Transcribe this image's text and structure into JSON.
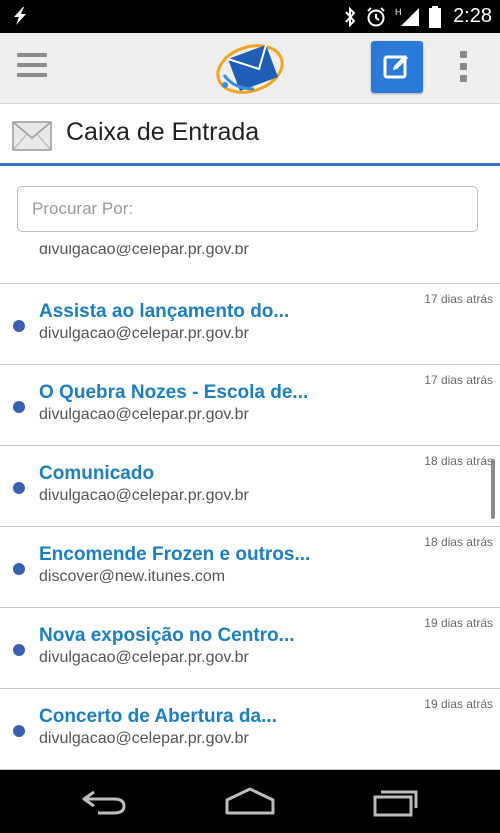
{
  "status_bar": {
    "time": "2:28",
    "left_icon": "flash-icon",
    "icons": [
      "bluetooth-icon",
      "alarm-icon",
      "signal-icon",
      "battery-icon"
    ],
    "network_label": "H"
  },
  "app_bar": {
    "menu_icon": "menu-icon",
    "logo": "mail-logo",
    "compose_icon": "compose-icon",
    "overflow_icon": "overflow-menu-icon"
  },
  "header": {
    "title": "Caixa de Entrada",
    "icon": "envelope-icon"
  },
  "search": {
    "placeholder": "Procurar Por:",
    "value": ""
  },
  "list": {
    "partial_sender": "divulgacao@celepar.pr.gov.br",
    "items": [
      {
        "subject": "Assista ao lançamento do...",
        "sender": "divulgacao@celepar.pr.gov.br",
        "date": "17 dias atrás"
      },
      {
        "subject": "O Quebra Nozes - Escola de...",
        "sender": "divulgacao@celepar.pr.gov.br",
        "date": "17 dias atrás"
      },
      {
        "subject": "Comunicado",
        "sender": "divulgacao@celepar.pr.gov.br",
        "date": "18 dias atrás"
      },
      {
        "subject": "Encomende Frozen e outros...",
        "sender": "discover@new.itunes.com",
        "date": "18 dias atrás"
      },
      {
        "subject": "Nova exposição no Centro...",
        "sender": "divulgacao@celepar.pr.gov.br",
        "date": "19 dias atrás"
      },
      {
        "subject": "Concerto de Abertura da...",
        "sender": "divulgacao@celepar.pr.gov.br",
        "date": "19 dias atrás"
      }
    ]
  },
  "nav_bar": {
    "buttons": [
      "back-icon",
      "home-icon",
      "recent-apps-icon"
    ]
  },
  "colors": {
    "accent": "#2a7bd8",
    "subject": "#1b7fc4",
    "unread_dot": "#3a5fb0",
    "header_rule": "#3d6fc2"
  }
}
